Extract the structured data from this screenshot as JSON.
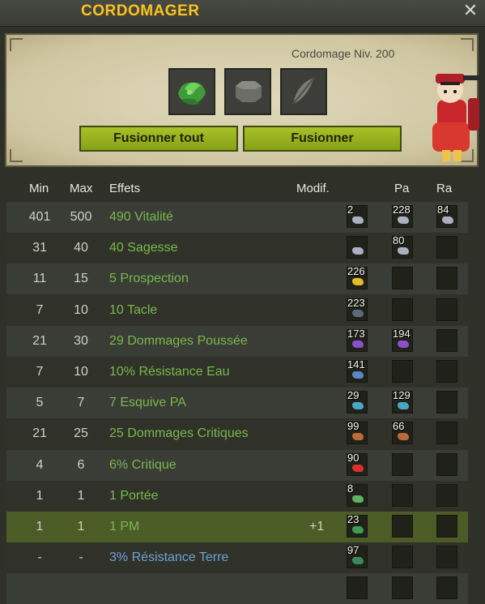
{
  "window": {
    "title": "CORDOMAGER",
    "close_icon": "close-icon"
  },
  "header": {
    "level_text": "Cordomage Niv. 200",
    "slots": [
      {
        "icon": "item-slot-icon"
      },
      {
        "icon": "rune-slot-icon"
      },
      {
        "icon": "feather-slot-icon"
      }
    ],
    "buttons": {
      "fuse_all": "Fusionner tout",
      "fuse": "Fusionner"
    }
  },
  "table": {
    "columns": {
      "min": "Min",
      "max": "Max",
      "effects": "Effets",
      "modif": "Modif.",
      "pa": "Pa",
      "ra": "Ra"
    },
    "rows": [
      {
        "min": "401",
        "max": "500",
        "effect": "490 Vitalité",
        "modif": "",
        "runes": [
          "2",
          "228",
          "84"
        ],
        "colors": [
          "#aab0c0",
          "#aab0c0",
          "#aab0c0"
        ]
      },
      {
        "min": "31",
        "max": "40",
        "effect": "40 Sagesse",
        "modif": "",
        "runes": [
          "",
          "80",
          null
        ],
        "colors": [
          "#aab0c0",
          "#aab0c0",
          null
        ]
      },
      {
        "min": "11",
        "max": "15",
        "effect": "5 Prospection",
        "modif": "",
        "runes": [
          "226",
          null,
          null
        ],
        "colors": [
          "#e7b92c",
          null,
          null
        ]
      },
      {
        "min": "7",
        "max": "10",
        "effect": "10 Tacle",
        "modif": "",
        "runes": [
          "223",
          null,
          null
        ],
        "colors": [
          "#5a6a7a",
          null,
          null
        ]
      },
      {
        "min": "21",
        "max": "30",
        "effect": "29 Dommages Poussée",
        "modif": "",
        "runes": [
          "173",
          "194",
          null
        ],
        "colors": [
          "#8a4fcc",
          "#8a4fcc",
          null
        ]
      },
      {
        "min": "7",
        "max": "10",
        "effect": "10% Résistance Eau",
        "modif": "",
        "runes": [
          "141",
          null,
          null
        ],
        "colors": [
          "#5a86c9",
          null,
          null
        ]
      },
      {
        "min": "5",
        "max": "7",
        "effect": "7 Esquive PA",
        "modif": "",
        "runes": [
          "29",
          "129",
          null
        ],
        "colors": [
          "#4aa6c8",
          "#4aa6c8",
          null
        ]
      },
      {
        "min": "21",
        "max": "25",
        "effect": "25 Dommages Critiques",
        "modif": "",
        "runes": [
          "99",
          "66",
          null
        ],
        "colors": [
          "#b96b3c",
          "#b96b3c",
          null
        ]
      },
      {
        "min": "4",
        "max": "6",
        "effect": "6% Critique",
        "modif": "",
        "runes": [
          "90",
          null,
          null
        ],
        "colors": [
          "#d8322a",
          null,
          null
        ]
      },
      {
        "min": "1",
        "max": "1",
        "effect": "1 Portée",
        "modif": "",
        "runes": [
          "8",
          null,
          null
        ],
        "colors": [
          "#5fb060",
          null,
          null
        ]
      },
      {
        "min": "1",
        "max": "1",
        "effect": "1 PM",
        "modif": "+1",
        "runes": [
          "23",
          null,
          null
        ],
        "colors": [
          "#3f9a56",
          null,
          null
        ],
        "selected": true
      },
      {
        "min": "-",
        "max": "-",
        "effect": "3% Résistance Terre",
        "modif": "",
        "runes": [
          "97",
          null,
          null
        ],
        "colors": [
          "#3a8a5a",
          null,
          null
        ],
        "blue": true
      },
      {
        "min": "",
        "max": "",
        "effect": "",
        "modif": "",
        "runes": [
          null,
          null,
          null
        ],
        "colors": [
          null,
          null,
          null
        ]
      }
    ]
  }
}
